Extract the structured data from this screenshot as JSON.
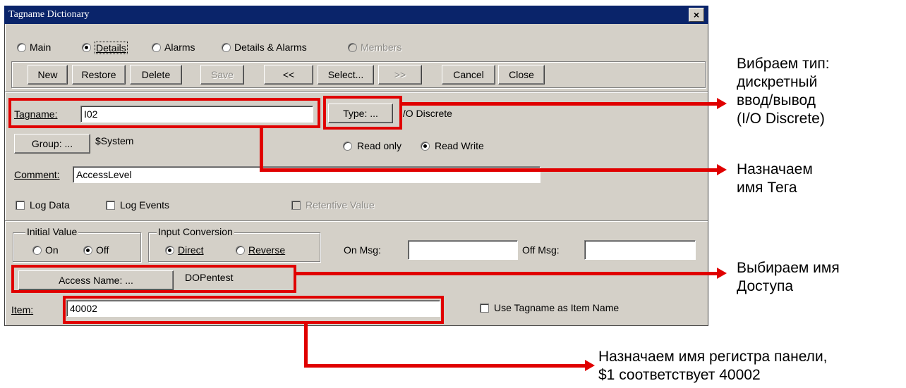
{
  "window": {
    "title": "Tagname Dictionary",
    "close_glyph": "×"
  },
  "view_options": [
    {
      "label": "Main",
      "selected": false,
      "enabled": true
    },
    {
      "label": "Details",
      "selected": true,
      "enabled": true
    },
    {
      "label": "Alarms",
      "selected": false,
      "enabled": true
    },
    {
      "label": "Details & Alarms",
      "selected": false,
      "enabled": true
    },
    {
      "label": "Members",
      "selected": false,
      "enabled": false
    }
  ],
  "toolbar": {
    "new": "New",
    "restore": "Restore",
    "delete": "Delete",
    "save": "Save",
    "prev": "<<",
    "select": "Select...",
    "next": ">>",
    "cancel": "Cancel",
    "close": "Close"
  },
  "tag": {
    "tagname_label": "Tagname:",
    "tagname_value": "I02",
    "type_button": "Type: ...",
    "type_value": "I/O Discrete",
    "group_button": "Group: ...",
    "group_value": "$System",
    "read_only": "Read only",
    "read_write": "Read Write",
    "access_mode": "Read Write",
    "comment_label": "Comment:",
    "comment_value": "AccessLevel",
    "log_data": "Log Data",
    "log_events": "Log Events",
    "retentive_value": "Retentive Value"
  },
  "io": {
    "initial_value_title": "Initial Value",
    "on": "On",
    "off": "Off",
    "initial_selected": "Off",
    "input_conversion_title": "Input Conversion",
    "direct": "Direct",
    "reverse": "Reverse",
    "conversion_selected": "Direct",
    "on_msg_label": "On Msg:",
    "on_msg_value": "",
    "off_msg_label": "Off Msg:",
    "off_msg_value": "",
    "access_name_button": "Access Name: ...",
    "access_name_value": "DOPentest",
    "item_label": "Item:",
    "item_value": "40002",
    "use_tagname_label": "Use Tagname as Item Name"
  },
  "annotations": {
    "type_note": "Вибраем тип:\nдискретный\nввод/вывод\n(I/O Discrete)",
    "tagname_note": "Назначаем\nимя Тега",
    "access_note": "Выбираем имя\nДоступа",
    "item_note": "Назначаем имя регистра панели,\n$1 соответствует 40002"
  },
  "colors": {
    "titlebar": "#0a246a",
    "dialog": "#d4d0c8",
    "annotation": "#e00000"
  }
}
